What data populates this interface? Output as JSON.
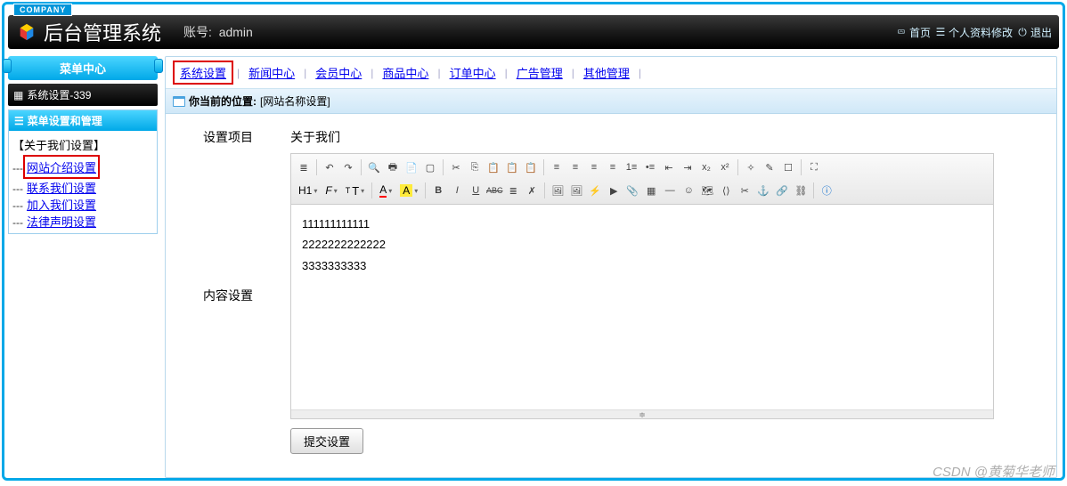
{
  "brand_tag": "COMPANY",
  "system_title": "后台管理系统",
  "account_label": "账号:",
  "account_value": "admin",
  "header_links": {
    "home": "首页",
    "profile": "个人资料修改",
    "logout": "退出"
  },
  "menu_center": "菜单中心",
  "tree_title": "系统设置-339",
  "panel_title": "菜单设置和管理",
  "sidebar_group": "【关于我们设置】",
  "sidebar_items": [
    "网站介绍设置",
    "联系我们设置",
    "加入我们设置",
    "法律声明设置"
  ],
  "tabs": [
    "系统设置",
    "新闻中心",
    "会员中心",
    "商品中心",
    "订单中心",
    "广告管理",
    "其他管理"
  ],
  "breadcrumb_label": "你当前的位置:",
  "breadcrumb_loc": "[网站名称设置]",
  "form": {
    "item_label": "设置项目",
    "item_value": "关于我们",
    "content_label": "内容设置",
    "content_lines": [
      "111111111111",
      "2222222222222",
      "3333333333"
    ]
  },
  "toolbar": {
    "h1": "H1",
    "font_family": "F",
    "font_size": "T",
    "font_color": "A",
    "bg_color": "A",
    "bold": "B",
    "italic": "I",
    "underline": "U",
    "strike": "ABC"
  },
  "submit": "提交设置",
  "watermark": "CSDN @黄菊华老师"
}
